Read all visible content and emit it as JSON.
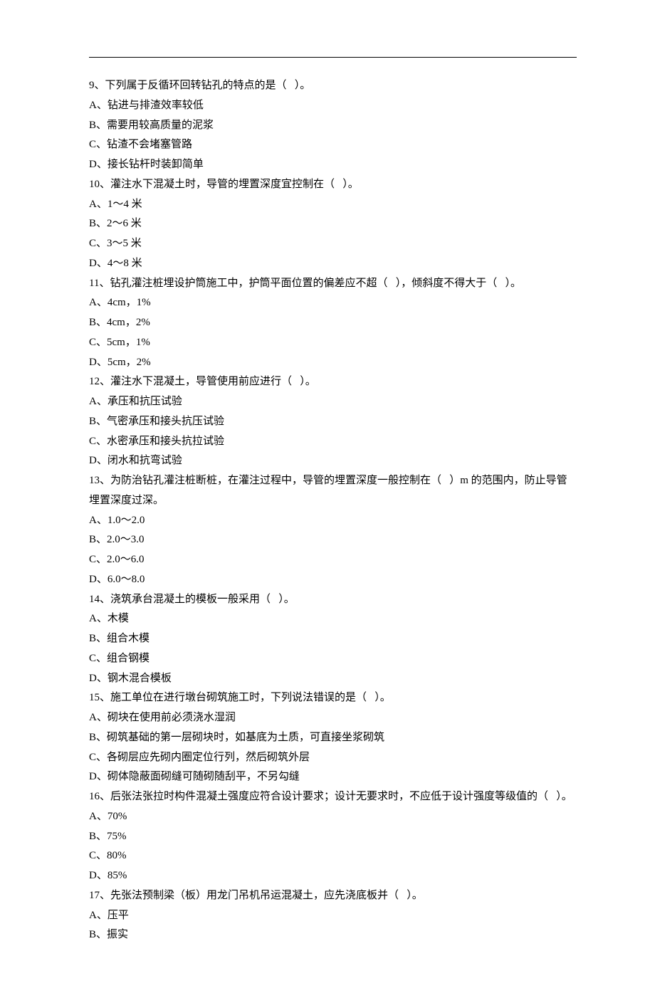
{
  "questions": [
    {
      "num": "9",
      "text": "下列属于反循环回转钻孔的特点的是（   ）。",
      "opts": [
        "A、钻进与排渣效率较低",
        "B、需要用较高质量的泥浆",
        "C、钻渣不会堵塞管路",
        "D、接长钻杆时装卸简单"
      ]
    },
    {
      "num": "10",
      "text": "灌注水下混凝土时，导管的埋置深度宜控制在（   ）。",
      "opts": [
        "A、1～4 米",
        "B、2～6 米",
        "C、3～5 米",
        "D、4～8 米"
      ]
    },
    {
      "num": "11",
      "text": "钻孔灌注桩埋设护筒施工中，护筒平面位置的偏差应不超（   ），倾斜度不得大于（   ）。",
      "opts": [
        "A、4cm，1%",
        "B、4cm，2%",
        "C、5cm，1%",
        "D、5cm，2%"
      ]
    },
    {
      "num": "12",
      "text": "灌注水下混凝土，导管使用前应进行（   ）。",
      "opts": [
        "A、承压和抗压试验",
        "B、气密承压和接头抗压试验",
        "C、水密承压和接头抗拉试验",
        "D、闭水和抗弯试验"
      ]
    },
    {
      "num": "13",
      "text": "为防治钻孔灌注桩断桩，在灌注过程中，导管的埋置深度一般控制在（   ）m 的范围内，防止导管埋置深度过深。",
      "opts": [
        "A、1.0～2.0",
        "B、2.0～3.0",
        "C、2.0～6.0",
        "D、6.0～8.0"
      ]
    },
    {
      "num": "14",
      "text": "浇筑承台混凝土的模板一般采用（   ）。",
      "opts": [
        "A、木模",
        "B、组合木模",
        "C、组合钢模",
        "D、钢木混合模板"
      ]
    },
    {
      "num": "15",
      "text": "施工单位在进行墩台砌筑施工时，下列说法错误的是（   ）。",
      "opts": [
        "A、砌块在使用前必须浇水湿润",
        "B、砌筑基础的第一层砌块时，如基底为土质，可直接坐浆砌筑",
        "C、各砌层应先砌内圈定位行列，然后砌筑外层",
        "D、砌体隐蔽面砌缝可随砌随刮平，不另勾缝"
      ]
    },
    {
      "num": "16",
      "text": "后张法张拉时构件混凝土强度应符合设计要求；设计无要求时，不应低于设计强度等级值的（   ）。",
      "opts": [
        "A、70%",
        "B、75%",
        "C、80%",
        "D、85%"
      ]
    },
    {
      "num": "17",
      "text": "先张法预制梁（板）用龙门吊机吊运混凝土，应先浇底板并（   ）。",
      "opts": [
        "A、压平",
        "B、振实"
      ]
    }
  ]
}
